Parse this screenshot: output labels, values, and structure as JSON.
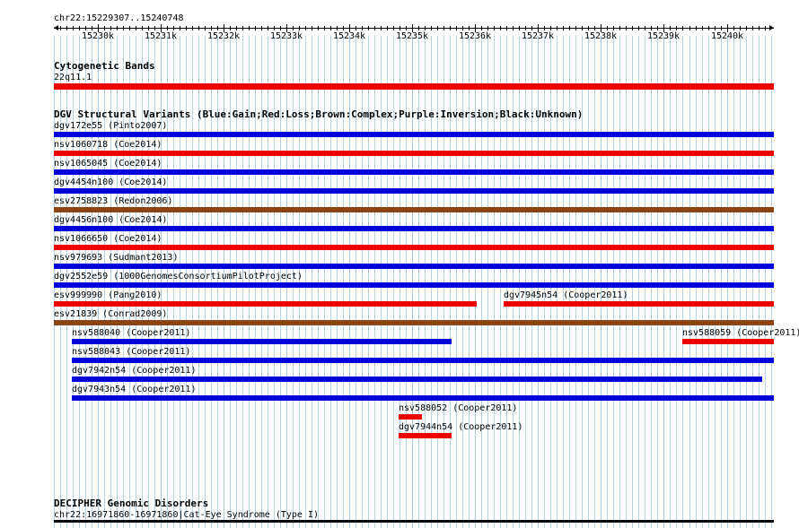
{
  "ruler": {
    "location": "chr22:15229307..15240748",
    "ticks": [
      "15230k",
      "15231k",
      "15232k",
      "15233k",
      "15234k",
      "15235k",
      "15236k",
      "15237k",
      "15238k",
      "15239k",
      "15240k"
    ]
  },
  "colors": {
    "gain": "#0000dd",
    "loss": "#ee0000",
    "complex": "#8b4513",
    "unknown": "#000000",
    "grid": "#b4d2e6"
  },
  "cytogenetic": {
    "title": "Cytogenetic Bands",
    "band": "22q11.1"
  },
  "dgv": {
    "title": "DGV Structural Variants (Blue:Gain;Red:Loss;Brown:Complex;Purple:Inversion;Black:Unknown)",
    "features": [
      {
        "label": "dgv172e55 (Pinto2007)",
        "type": "gain",
        "start_kb": 15229.3,
        "end_kb": 15240.75
      },
      {
        "label": "nsv1060718 (Coe2014)",
        "type": "loss",
        "start_kb": 15229.3,
        "end_kb": 15240.75
      },
      {
        "label": "nsv1065045 (Coe2014)",
        "type": "gain",
        "start_kb": 15229.3,
        "end_kb": 15240.75
      },
      {
        "label": "dgv4454n100 (Coe2014)",
        "type": "gain",
        "start_kb": 15229.3,
        "end_kb": 15240.75
      },
      {
        "label": "esv2758823 (Redon2006)",
        "type": "complex",
        "start_kb": 15229.3,
        "end_kb": 15240.75
      },
      {
        "label": "dgv4456n100 (Coe2014)",
        "type": "gain",
        "start_kb": 15229.3,
        "end_kb": 15240.75
      },
      {
        "label": "nsv1066650 (Coe2014)",
        "type": "loss",
        "start_kb": 15229.3,
        "end_kb": 15240.75
      },
      {
        "label": "nsv979693 (Sudmant2013)",
        "type": "gain",
        "start_kb": 15229.3,
        "end_kb": 15240.75
      },
      {
        "label": "dgv2552e59 (1000GenomesConsortiumPilotProject)",
        "type": "gain",
        "start_kb": 15229.3,
        "end_kb": 15240.75
      },
      {
        "label": "esv999990 (Pang2010)",
        "type": "loss",
        "start_kb": 15229.3,
        "end_kb": 15236.03
      },
      {
        "label": "dgv7945n54 (Cooper2011)",
        "type": "loss",
        "start_kb": 15236.45,
        "end_kb": 15240.75
      },
      {
        "label": "esv21839 (Conrad2009)",
        "type": "complex",
        "start_kb": 15229.3,
        "end_kb": 15240.75
      },
      {
        "label": "nsv588040 (Cooper2011)",
        "type": "gain",
        "start_kb": 15229.59,
        "end_kb": 15235.63
      },
      {
        "label": "nsv588059 (Cooper2011)",
        "type": "loss",
        "start_kb": 15239.29,
        "end_kb": 15240.75
      },
      {
        "label": "nsv588043 (Cooper2011)",
        "type": "gain",
        "start_kb": 15229.59,
        "end_kb": 15240.75
      },
      {
        "label": "dgv7942n54 (Cooper2011)",
        "type": "gain",
        "start_kb": 15229.59,
        "end_kb": 15240.56
      },
      {
        "label": "dgv7943n54 (Cooper2011)",
        "type": "gain",
        "start_kb": 15229.59,
        "end_kb": 15240.75
      },
      {
        "label": "nsv588052 (Cooper2011)",
        "type": "loss",
        "start_kb": 15234.78,
        "end_kb": 15235.16
      },
      {
        "label": "dgv7944n54 (Cooper2011)",
        "type": "loss",
        "start_kb": 15234.78,
        "end_kb": 15235.63
      }
    ]
  },
  "decipher": {
    "title": "DECIPHER Genomic Disorders",
    "feature": "chr22:16971860-16971860|Cat-Eye Syndrome (Type I)"
  }
}
